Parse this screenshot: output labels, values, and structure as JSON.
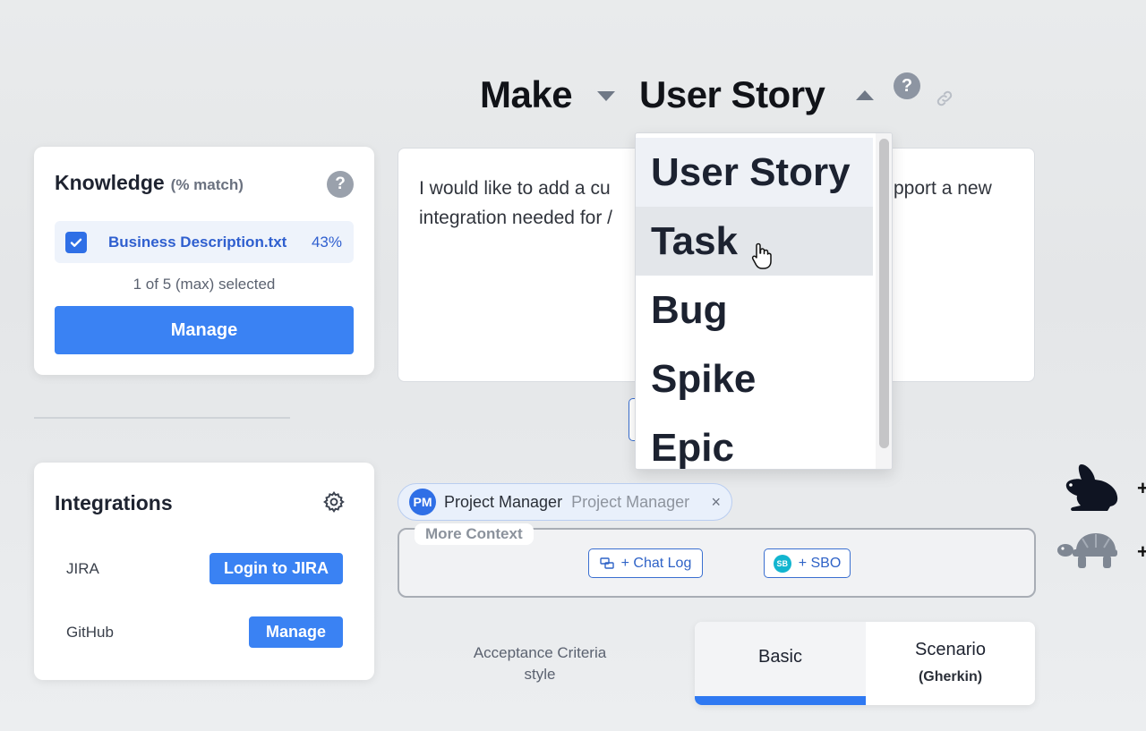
{
  "header": {
    "make_label": "Make",
    "type_label": "User Story",
    "help_label": "?"
  },
  "knowledge": {
    "title": "Knowledge",
    "subtitle": "(% match)",
    "help_label": "?",
    "file_name": "Business Description.txt",
    "file_match": "43%",
    "file_checked": true,
    "selected_text": "1 of 5 (max) selected",
    "manage_label": "Manage"
  },
  "integrations": {
    "title": "Integrations",
    "rows": [
      {
        "name": "JIRA",
        "button": "Login to JIRA"
      },
      {
        "name": "GitHub",
        "button": "Manage"
      }
    ]
  },
  "prompt": {
    "line1_left": "I would like to add a cu",
    "line1_right": "pport a new",
    "line2_left": "integration needed for /"
  },
  "dropdown": {
    "items": [
      "User Story",
      "Task",
      "Bug",
      "Spike",
      "Epic"
    ],
    "selected": "User Story",
    "hovered": "Task"
  },
  "persona": {
    "initials": "PM",
    "name": "Project Manager",
    "role": "Project Manager",
    "remove": "×"
  },
  "context": {
    "label": "More Context",
    "chat_log": "+ Chat Log",
    "sbo_badge": "SB",
    "sbo": "+ SBO"
  },
  "acceptance": {
    "label_line1": "Acceptance Criteria",
    "label_line2": "style",
    "options": [
      {
        "label": "Basic",
        "sub": ""
      },
      {
        "label": "Scenario",
        "sub": "(Gherkin)"
      }
    ],
    "active": "Basic"
  },
  "speed": {
    "fast_plus": "+",
    "slow_plus": "+"
  },
  "colors": {
    "accent": "#3a82f3",
    "link_blue": "#2f63c7",
    "hover_bg": "#e3e6ea",
    "selected_bg": "#eef1f6"
  }
}
